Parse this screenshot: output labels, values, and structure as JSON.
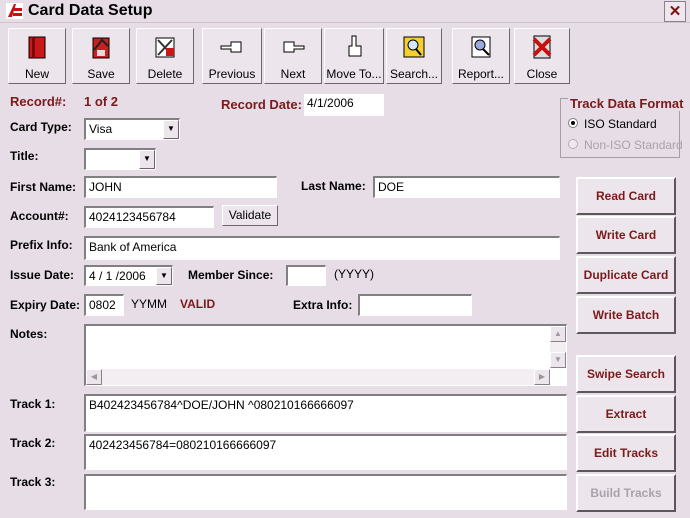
{
  "window": {
    "title": "Card Data Setup",
    "close_glyph": "✕"
  },
  "toolbar": [
    {
      "label": "New",
      "icon": "new-card-icon"
    },
    {
      "label": "Save",
      "icon": "save-icon"
    },
    {
      "label": "Delete",
      "icon": "delete-icon"
    },
    {
      "label": "Previous",
      "icon": "hand-left-icon"
    },
    {
      "label": "Next",
      "icon": "hand-right-icon"
    },
    {
      "label": "Move To...",
      "icon": "hand-point-icon"
    },
    {
      "label": "Search...",
      "icon": "search-icon"
    },
    {
      "label": "Report...",
      "icon": "report-icon"
    },
    {
      "label": "Close",
      "icon": "close-icon"
    }
  ],
  "record": {
    "label": "Record#:",
    "value": "1 of 2",
    "date_label": "Record Date:",
    "date_value": "4/1/2006"
  },
  "track_format": {
    "title": "Track Data Format",
    "opt1": "ISO Standard",
    "opt2": "Non-ISO Standard",
    "selected": "ISO Standard"
  },
  "form": {
    "card_type_label": "Card Type:",
    "card_type": "Visa",
    "title_label": "Title:",
    "title": "",
    "first_name_label": "First Name:",
    "first_name": "JOHN",
    "last_name_label": "Last Name:",
    "last_name": "DOE",
    "account_label": "Account#:",
    "account": "4024123456784",
    "validate": "Validate",
    "prefix_label": "Prefix Info:",
    "prefix": "Bank of America",
    "issue_label": "Issue Date:",
    "issue": "4 / 1 /2006",
    "member_label": "Member Since:",
    "member": "",
    "member_hint": "(YYYY)",
    "expiry_label": "Expiry Date:",
    "expiry": "0802",
    "expiry_hint": "YYMM",
    "status": "VALID",
    "extra_label": "Extra Info:",
    "extra": "",
    "notes_label": "Notes:",
    "notes": "",
    "track1_label": "Track 1:",
    "track1": "B402423456784^DOE/JOHN ^080210166666097",
    "track2_label": "Track 2:",
    "track2": "402423456784=080210166666097",
    "track3_label": "Track 3:",
    "track3": ""
  },
  "actions": [
    "Read Card",
    "Write Card",
    "Duplicate Card",
    "Write Batch",
    "Swipe Search",
    "Extract",
    "Edit Tracks",
    "Build Tracks"
  ],
  "colors": {
    "accent": "#7a1a1a",
    "background": "#e6dde6"
  }
}
